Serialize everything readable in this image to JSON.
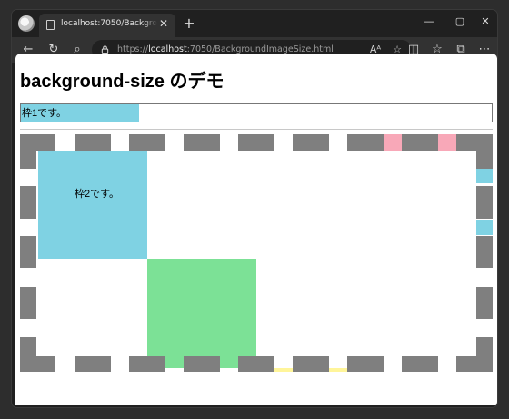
{
  "browser": {
    "tab_title": "localhost:7050/BackgroundImageSize.html",
    "tab_close_glyph": "✕",
    "new_tab_glyph": "+",
    "url_scheme": "https://",
    "url_host": "localhost",
    "url_path": ":7050/BackgroundImageSize.html",
    "window_controls": {
      "minimize": "—",
      "maximize": "▢",
      "close": "✕"
    },
    "toolbar_icons": [
      "back-arrow-icon",
      "refresh-icon",
      "search-icon",
      "lock-icon",
      "read-aloud-icon",
      "favorite-star-icon",
      "split-screen-icon",
      "favorites-icon",
      "collections-icon",
      "more-icon"
    ],
    "read_aloud_glyph": "Aᴬ",
    "favorite_glyph": "☆",
    "back_glyph": "←",
    "refresh_glyph": "↻",
    "search_glyph": "⌕",
    "split_glyph": "◫",
    "favorites_glyph": "☆",
    "collections_glyph": "⧉",
    "more_glyph": "⋯"
  },
  "page": {
    "heading": "background-size のデモ",
    "frame1_label": "枠1です。",
    "frame2_label": "枠2です。"
  },
  "colors": {
    "frame1_fill": "#7fd2e3",
    "tile_blue": "#7fd2e3",
    "tile_green": "#7ce196",
    "border_dash": "#7f7f7f",
    "accent_pink": "#f8a8b8",
    "accent_yellow": "#fff59a",
    "accent_cyan": "#7fd2e3"
  }
}
